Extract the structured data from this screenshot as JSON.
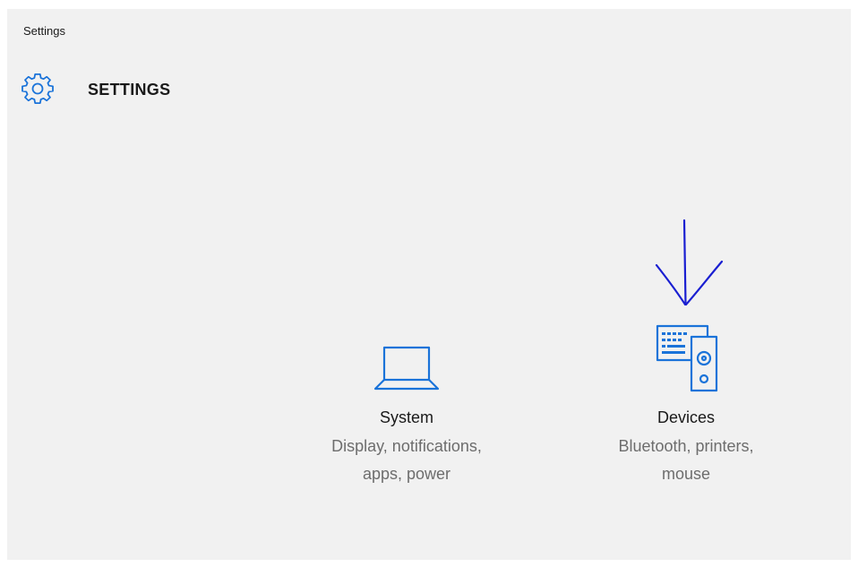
{
  "window": {
    "title": "Settings"
  },
  "header": {
    "title": "SETTINGS",
    "icon": "gear-icon"
  },
  "tiles": [
    {
      "label": "System",
      "description": "Display, notifications, apps, power",
      "icon": "laptop-icon"
    },
    {
      "label": "Devices",
      "description": "Bluetooth, printers, mouse",
      "icon": "devices-icon"
    }
  ],
  "colors": {
    "accent": "#1a73d9",
    "background": "#f1f1f1",
    "annotation": "#1a1fd1"
  }
}
